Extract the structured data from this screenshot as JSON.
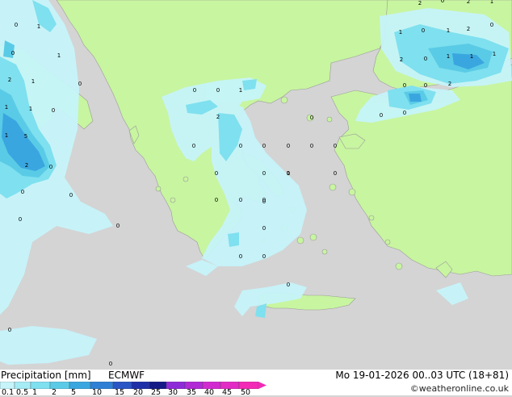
{
  "footer": {
    "title": "Precipitation [mm]",
    "model": "ECMWF",
    "valid_time": "Mo 19-01-2026 00..03 UTC (18+81)",
    "credit": "©weatheronline.co.uk"
  },
  "legend": {
    "ticks": [
      "0.1",
      "0.5",
      "1",
      "2",
      "5",
      "10",
      "15",
      "20",
      "25",
      "30",
      "35",
      "40",
      "45",
      "50"
    ],
    "colors": [
      "#c6f4fa",
      "#a5ecf5",
      "#7fe0ef",
      "#5acbe6",
      "#3aa6e0",
      "#2f7fd4",
      "#2a55c4",
      "#1f2fa8",
      "#141a86",
      "#8e2bd8",
      "#b02ad6",
      "#d12bd0",
      "#e22bc4",
      "#f22ab6"
    ]
  },
  "map": {
    "land_color": "#c8f5a0",
    "sea_color": "#d4d4d4",
    "values": [
      "0",
      "1",
      "1",
      "0",
      "2",
      "1",
      "0",
      "0",
      "2",
      "1",
      "1",
      "0",
      "1",
      "5",
      "0",
      "0",
      "0",
      "0",
      "0",
      "0",
      "0",
      "0",
      "1",
      "0",
      "0",
      "0",
      "0",
      "0",
      "1",
      "0",
      "0",
      "0",
      "0",
      "0",
      "0",
      "0",
      "0",
      "0",
      "0",
      "0",
      "0",
      "0",
      "0",
      "2",
      "0",
      "1",
      "0",
      "1",
      "2",
      "0",
      "2",
      "1",
      "1",
      "2",
      "0",
      "2",
      "1",
      "1",
      "2",
      "0",
      "0",
      "0",
      "0"
    ]
  }
}
